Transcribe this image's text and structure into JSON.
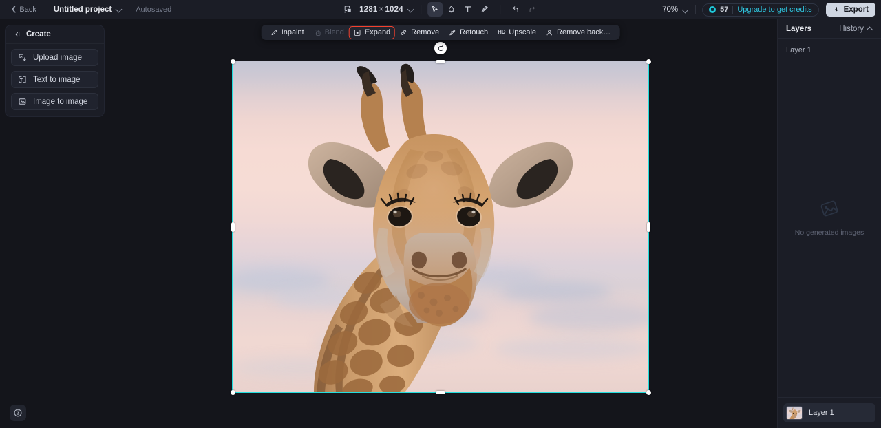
{
  "topbar": {
    "back_label": "Back",
    "project_name": "Untitled project",
    "autosaved_label": "Autosaved",
    "canvas_icon": "canvas-size-icon",
    "dimensions": {
      "width": "1281",
      "separator": "×",
      "height": "1024"
    },
    "tools": [
      {
        "id": "select",
        "icon": "cursor-icon",
        "active": true,
        "disabled": false
      },
      {
        "id": "eraser",
        "icon": "eraser-icon",
        "active": false,
        "disabled": false
      },
      {
        "id": "text",
        "icon": "text-icon",
        "active": false,
        "disabled": false
      },
      {
        "id": "brush",
        "icon": "brush-icon",
        "active": false,
        "disabled": false
      },
      {
        "id": "undo",
        "icon": "undo-icon",
        "active": false,
        "disabled": false
      },
      {
        "id": "redo",
        "icon": "redo-icon",
        "active": false,
        "disabled": true
      }
    ],
    "zoom_level": "70%",
    "credits": {
      "icon": "coin-icon",
      "count": "57",
      "upgrade_label": "Upgrade to get credits"
    },
    "export_label": "Export",
    "export_icon": "download-icon"
  },
  "left_panel": {
    "header_label": "Create",
    "header_icon": "collapse-panel-icon",
    "items": [
      {
        "label": "Upload image",
        "icon": "upload-image-icon"
      },
      {
        "label": "Text to image",
        "icon": "text-to-image-icon"
      },
      {
        "label": "Image to image",
        "icon": "image-to-image-icon"
      }
    ]
  },
  "canvas_toolbar": {
    "items": [
      {
        "label": "Inpaint",
        "icon": "inpaint-icon",
        "disabled": false,
        "highlighted": false
      },
      {
        "label": "Blend",
        "icon": "blend-icon",
        "disabled": true,
        "highlighted": false
      },
      {
        "label": "Expand",
        "icon": "expand-icon",
        "disabled": false,
        "highlighted": true
      },
      {
        "label": "Remove",
        "icon": "remove-icon",
        "disabled": false,
        "highlighted": false
      },
      {
        "label": "Retouch",
        "icon": "retouch-icon",
        "disabled": false,
        "highlighted": false
      },
      {
        "label": "Upscale",
        "icon": "hd-upscale-icon",
        "badge": "HD",
        "disabled": false,
        "highlighted": false
      },
      {
        "label": "Remove back…",
        "icon": "remove-background-icon",
        "disabled": false,
        "highlighted": false
      }
    ],
    "highlight_color": "#f4412d"
  },
  "canvas": {
    "selection_color": "#23dede",
    "rotate_icon": "rotate-icon",
    "image_alt": "giraffe-photo"
  },
  "right_panel": {
    "title": "Layers",
    "history_label": "History",
    "history_icon": "chevron-up-icon",
    "layer_group_label": "Layer 1",
    "empty_icon": "no-images-icon",
    "empty_text": "No generated images",
    "layer": {
      "name": "Layer 1",
      "thumb_icon": "layer-thumbnail"
    }
  },
  "help": {
    "icon": "help-circle-icon"
  }
}
